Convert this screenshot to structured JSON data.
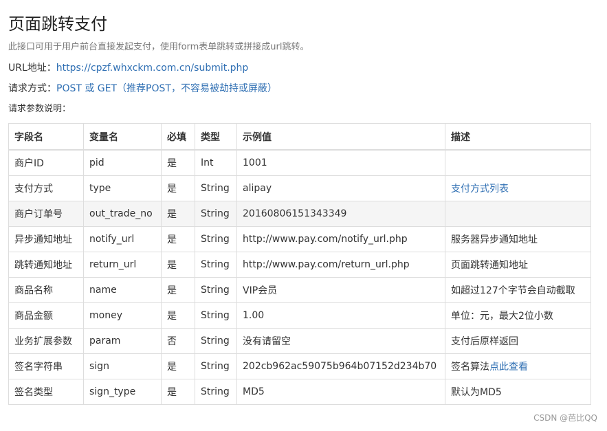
{
  "title": "页面跳转支付",
  "description": "此接口可用于用户前台直接发起支付，使用form表单跳转或拼接成url跳转。",
  "url": {
    "label": "URL地址：",
    "value": "https://cpzf.whxckm.com.cn/submit.php"
  },
  "method": {
    "label": "请求方式：",
    "value": "POST 或 GET（推荐POST，不容易被劫持或屏蔽）"
  },
  "params_label": "请求参数说明：",
  "table": {
    "headers": [
      "字段名",
      "变量名",
      "必填",
      "类型",
      "示例值",
      "描述"
    ],
    "rows": [
      {
        "field": "商户ID",
        "var": "pid",
        "required": "是",
        "type": "Int",
        "example": "1001",
        "desc": "",
        "desc_link": ""
      },
      {
        "field": "支付方式",
        "var": "type",
        "required": "是",
        "type": "String",
        "example": "alipay",
        "desc": "",
        "desc_link": "支付方式列表"
      },
      {
        "field": "商户订单号",
        "var": "out_trade_no",
        "required": "是",
        "type": "String",
        "example": "20160806151343349",
        "desc": "",
        "desc_link": ""
      },
      {
        "field": "异步通知地址",
        "var": "notify_url",
        "required": "是",
        "type": "String",
        "example": "http://www.pay.com/notify_url.php",
        "desc": "服务器异步通知地址",
        "desc_link": ""
      },
      {
        "field": "跳转通知地址",
        "var": "return_url",
        "required": "是",
        "type": "String",
        "example": "http://www.pay.com/return_url.php",
        "desc": "页面跳转通知地址",
        "desc_link": ""
      },
      {
        "field": "商品名称",
        "var": "name",
        "required": "是",
        "type": "String",
        "example": "VIP会员",
        "desc": "如超过127个字节会自动截取",
        "desc_link": ""
      },
      {
        "field": "商品金额",
        "var": "money",
        "required": "是",
        "type": "String",
        "example": "1.00",
        "desc": "单位：元，最大2位小数",
        "desc_link": ""
      },
      {
        "field": "业务扩展参数",
        "var": "param",
        "required": "否",
        "type": "String",
        "example": "没有请留空",
        "desc": "支付后原样返回",
        "desc_link": ""
      },
      {
        "field": "签名字符串",
        "var": "sign",
        "required": "是",
        "type": "String",
        "example": "202cb962ac59075b964b07152d234b70",
        "desc": "签名算法",
        "desc_link": "点此查看"
      },
      {
        "field": "签名类型",
        "var": "sign_type",
        "required": "是",
        "type": "String",
        "example": "MD5",
        "desc": "默认为MD5",
        "desc_link": ""
      }
    ]
  },
  "footer": "CSDN @芭比QQ",
  "colors": {
    "link": "#2f6fb3",
    "border": "#dddddd",
    "stripe": "#f5f5f5"
  }
}
